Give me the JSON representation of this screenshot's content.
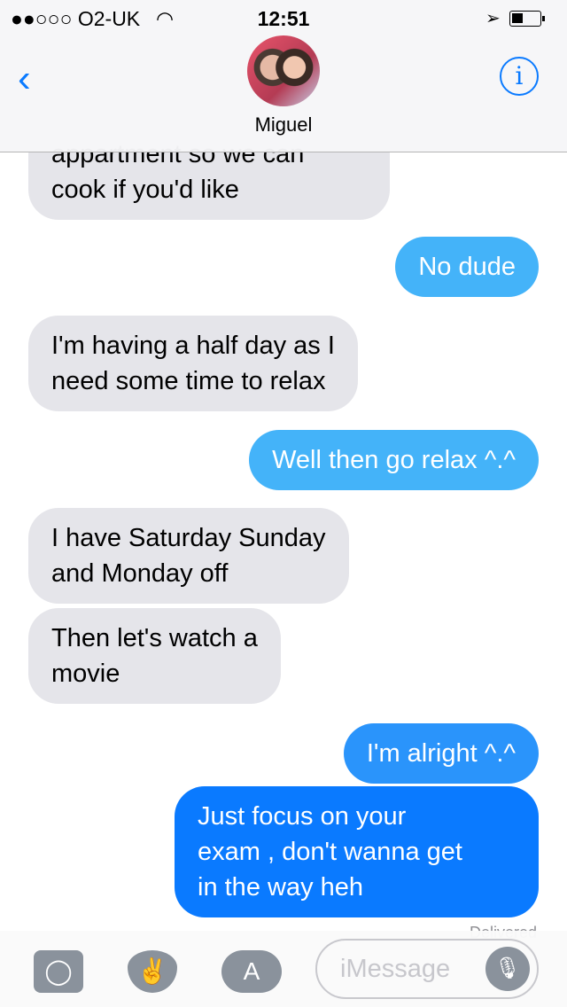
{
  "status": {
    "carrier": "●●○○○ O2-UK",
    "wifi": "wifi-icon",
    "time": "12:51"
  },
  "header": {
    "back": "‹",
    "contact_name": "Miguel",
    "info": "i"
  },
  "messages": [
    {
      "dir": "received",
      "lines": [
        "appartment so we can",
        "cook if you'd like"
      ]
    },
    {
      "dir": "sent",
      "lines": [
        "No dude"
      ]
    },
    {
      "dir": "received",
      "lines": [
        "I'm having a half day as I",
        "need some time to relax"
      ]
    },
    {
      "dir": "sent",
      "lines": [
        "Well then go relax ^.^"
      ]
    },
    {
      "dir": "received",
      "lines": [
        "I have Saturday Sunday",
        "and Monday off"
      ]
    },
    {
      "dir": "received",
      "lines": [
        "Then let's watch a",
        "movie"
      ]
    },
    {
      "dir": "sent",
      "lines": [
        "I'm alright ^.^"
      ]
    },
    {
      "dir": "sent",
      "lines": [
        "Just focus on your",
        "exam , don't wanna get",
        "in the way heh"
      ]
    }
  ],
  "delivered": "Delivered",
  "input": {
    "placeholder": "iMessage"
  },
  "colors": {
    "accent": "#0a7aff",
    "received_bg": "#e5e5ea"
  }
}
